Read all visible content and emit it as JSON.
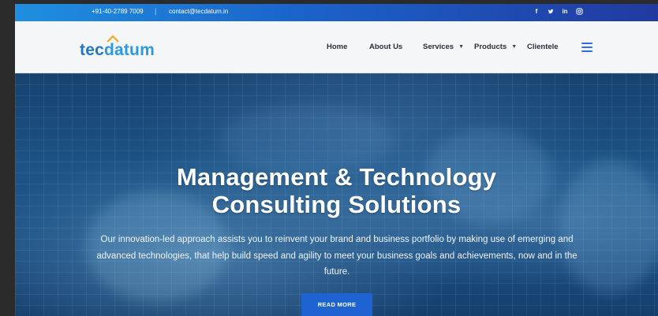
{
  "topbar": {
    "phone": "+91-40-2789 7009",
    "separator": "|",
    "email": "contact@tecdatum.in",
    "social": [
      "facebook-icon",
      "twitter-icon",
      "linkedin-icon",
      "instagram-icon"
    ]
  },
  "header": {
    "logo": {
      "part1": "tec",
      "part2": "datum"
    },
    "nav": [
      {
        "label": "Home"
      },
      {
        "label": "About Us"
      },
      {
        "label": "Services"
      },
      {
        "label": "Products"
      },
      {
        "label": "Clientele"
      }
    ]
  },
  "hero": {
    "title_line1": "Management & Technology",
    "title_line2": "Consulting Solutions",
    "description": "Our innovation-led approach assists you to reinvent your brand and business portfolio by making use of emerging and advanced technologies, that help build speed and agility to meet your business goals and achievements, now and in the future.",
    "button": "READ MORE"
  },
  "colors": {
    "topbar_start": "#1f8fe0",
    "topbar_end": "#213aa0",
    "accent": "#1f63d2",
    "logo_blue": "#1e78c8"
  }
}
